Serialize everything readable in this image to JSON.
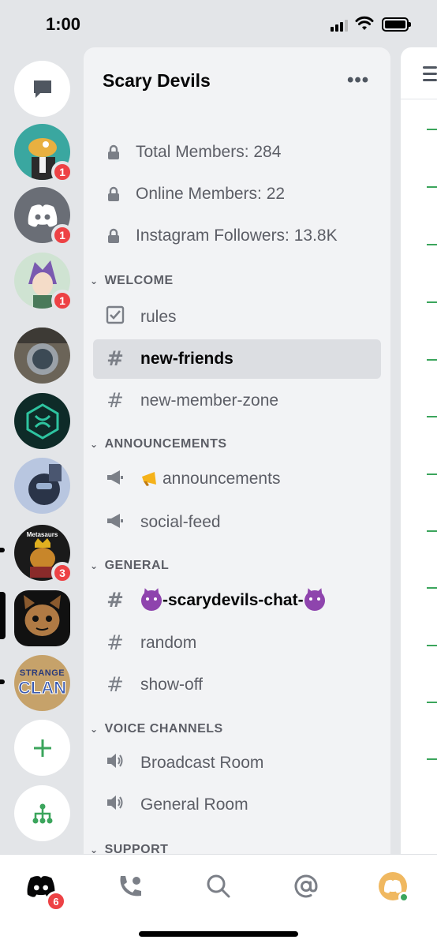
{
  "status_bar": {
    "time": "1:00"
  },
  "server_rail": {
    "items": [
      {
        "name": "direct-messages",
        "badge": null
      },
      {
        "name": "server-dino",
        "badge": "1"
      },
      {
        "name": "server-discord",
        "badge": "1"
      },
      {
        "name": "server-anime",
        "badge": "1"
      },
      {
        "name": "server-astronaut",
        "badge": null
      },
      {
        "name": "server-hexagon",
        "badge": null
      },
      {
        "name": "server-robot",
        "badge": null
      },
      {
        "name": "server-metasaurs",
        "badge": "3",
        "label": "Metasaurs"
      },
      {
        "name": "server-scary-devils",
        "badge": null
      },
      {
        "name": "server-strange-clan",
        "badge": null,
        "label_line1": "STRANGE",
        "label_line2": "CLAN"
      }
    ]
  },
  "server": {
    "name": "Scary Devils",
    "stats": [
      "Total Members: 284",
      "Online Members: 22",
      "Instagram Followers: 13.8K"
    ],
    "categories": [
      {
        "name": "WELCOME",
        "channels": [
          {
            "label": "rules",
            "type": "rules"
          },
          {
            "label": "new-friends",
            "type": "text",
            "active": true
          },
          {
            "label": "new-member-zone",
            "type": "text"
          }
        ]
      },
      {
        "name": "ANNOUNCEMENTS",
        "channels": [
          {
            "label": "announcements",
            "type": "announcement",
            "emoji": "megaphone"
          },
          {
            "label": "social-feed",
            "type": "announcement"
          }
        ]
      },
      {
        "name": "GENERAL",
        "channels": [
          {
            "label": "-scarydevils-chat-",
            "type": "text",
            "unread": true,
            "emoji": "smiling-imp"
          },
          {
            "label": "random",
            "type": "text"
          },
          {
            "label": "show-off",
            "type": "text"
          }
        ]
      },
      {
        "name": "VOICE CHANNELS",
        "channels": [
          {
            "label": "Broadcast Room",
            "type": "voice"
          },
          {
            "label": "General Room",
            "type": "voice"
          }
        ]
      },
      {
        "name": "SUPPORT",
        "channels": []
      }
    ]
  },
  "tab_bar": {
    "tabs": [
      "home",
      "friends",
      "search",
      "mentions",
      "profile"
    ],
    "home_badge": "6"
  },
  "colors": {
    "rail_bg": "#e3e5e8",
    "panel_bg": "#f2f3f5",
    "active_channel_bg": "#dcdee2",
    "badge_red": "#ed4245",
    "online_green": "#3ba55c"
  }
}
